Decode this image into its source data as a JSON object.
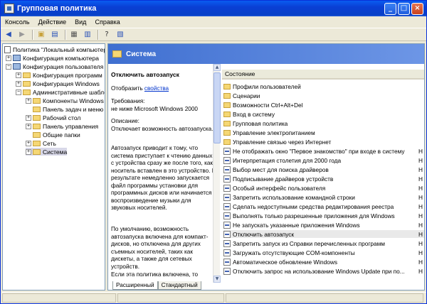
{
  "window": {
    "title": "Групповая политика"
  },
  "menu": [
    "Консоль",
    "Действие",
    "Вид",
    "Справка"
  ],
  "toolbar": [
    "back-icon",
    "forward-icon",
    "up-folder-icon",
    "show-tree-icon",
    "properties-icon",
    "export-icon",
    "help-icon",
    "view-icon"
  ],
  "tree": [
    {
      "label": "Политика \"Локальный компьютер\"",
      "depth": 0,
      "expander": "−",
      "icon": "doc"
    },
    {
      "label": "Конфигурация компьютера",
      "depth": 1,
      "expander": "+",
      "icon": "pc"
    },
    {
      "label": "Конфигурация пользователя",
      "depth": 1,
      "expander": "−",
      "icon": "pc"
    },
    {
      "label": "Конфигурация программ",
      "depth": 2,
      "expander": "+",
      "icon": "folder"
    },
    {
      "label": "Конфигурация Windows",
      "depth": 2,
      "expander": "+",
      "icon": "folder"
    },
    {
      "label": "Административные шаблоны",
      "depth": 2,
      "expander": "−",
      "icon": "folder"
    },
    {
      "label": "Компоненты Windows",
      "depth": 3,
      "expander": "+",
      "icon": "folder"
    },
    {
      "label": "Панель задач и меню \"Пуск\"",
      "depth": 3,
      "expander": "",
      "icon": "folder"
    },
    {
      "label": "Рабочий стол",
      "depth": 3,
      "expander": "+",
      "icon": "folder"
    },
    {
      "label": "Панель управления",
      "depth": 3,
      "expander": "+",
      "icon": "folder"
    },
    {
      "label": "Общие папки",
      "depth": 3,
      "expander": "",
      "icon": "folder"
    },
    {
      "label": "Сеть",
      "depth": 3,
      "expander": "+",
      "icon": "folder"
    },
    {
      "label": "Система",
      "depth": 3,
      "expander": "+",
      "icon": "folder"
    }
  ],
  "header": {
    "title": "Система"
  },
  "description": {
    "policy_title": "Отключить автозапуск",
    "show_prefix": "Отобразить",
    "show_link": "свойства",
    "requirements": "Требования:\nне ниже Microsoft Windows 2000",
    "description_label": "Описание:\nОтключает возможность автозапуска.",
    "body1": "Автозапуск приводит к тому, что система приступает к чтению данных с устройства сразу же после того, как носитель вставлен в это устройство. В результате немедленно запускается файл программы установки для программных дисков или начинается воспроизведение музыки для звуковых носителей.",
    "body2": "По умолчанию, возможность автозапуска включена для компакт-дисков, но отключена для других съемных носителей, таких как дискеты, а также для сетевых устройств.",
    "body3": "Если эта политика включена, то"
  },
  "list": {
    "column": "Состояние",
    "rows": [
      {
        "label": "Профили пользователей",
        "icon": "folder",
        "state": ""
      },
      {
        "label": "Сценарии",
        "icon": "folder",
        "state": ""
      },
      {
        "label": "Возможности Ctrl+Alt+Del",
        "icon": "folder",
        "state": ""
      },
      {
        "label": "Вход в систему",
        "icon": "folder",
        "state": ""
      },
      {
        "label": "Групповая политика",
        "icon": "folder",
        "state": ""
      },
      {
        "label": "Управление электропитанием",
        "icon": "folder",
        "state": ""
      },
      {
        "label": "Управление связью через Интернет",
        "icon": "folder",
        "state": ""
      },
      {
        "label": "Не отображать окно \"Первое знакомство\" при входе в систему",
        "icon": "policy",
        "state": "Н"
      },
      {
        "label": "Интерпретация столетия для 2000 года",
        "icon": "policy",
        "state": "Н"
      },
      {
        "label": "Выбор мест для поиска драйверов",
        "icon": "policy",
        "state": "Н"
      },
      {
        "label": "Подписывание драйверов устройств",
        "icon": "policy",
        "state": "Н"
      },
      {
        "label": "Особый интерфейс пользователя",
        "icon": "policy",
        "state": "Н"
      },
      {
        "label": "Запретить использование командной строки",
        "icon": "policy",
        "state": "Н"
      },
      {
        "label": "Сделать недоступными средства редактирования реестра",
        "icon": "policy",
        "state": "Н"
      },
      {
        "label": "Выполнять только разрешенные приложения для Windows",
        "icon": "policy",
        "state": "Н"
      },
      {
        "label": "Не запускать указанные приложения Windows",
        "icon": "policy",
        "state": "Н"
      },
      {
        "label": "Отключить автозапуск",
        "icon": "policy",
        "state": "Н"
      },
      {
        "label": "Запретить запуск из Справки перечисленных программ",
        "icon": "policy",
        "state": "Н"
      },
      {
        "label": "Загружать отсутствующие COM-компоненты",
        "icon": "policy",
        "state": "Н"
      },
      {
        "label": "Автоматическое обновление Windows",
        "icon": "policy",
        "state": "Н"
      },
      {
        "label": "Отключить запрос на использование Windows Update при по...",
        "icon": "policy",
        "state": "Н"
      }
    ]
  },
  "tabs": {
    "extended": "Расширенный",
    "standard": "Стандартный"
  }
}
